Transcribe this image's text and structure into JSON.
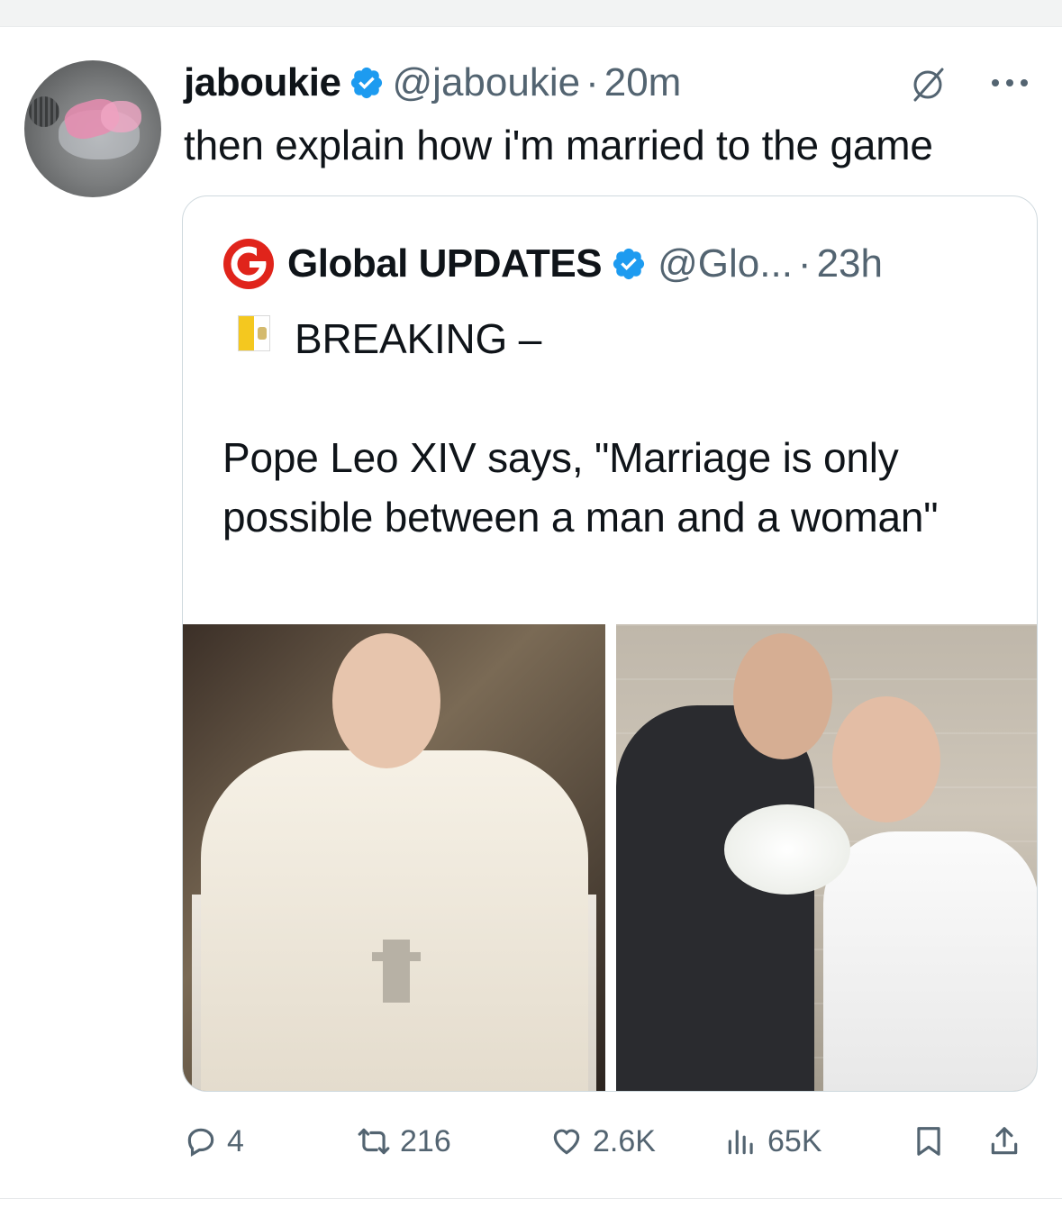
{
  "tweet": {
    "author_name": "jaboukie",
    "author_handle": "@jaboukie",
    "separator": "·",
    "time": "20m",
    "text": "then explain how i'm married to the game"
  },
  "quoted": {
    "author_name": "Global UPDATES",
    "author_handle": "@Glo...",
    "separator": "·",
    "time": "23h",
    "logo_letter": "G",
    "text": "BREAKING –\n\nPope Leo XIV says, \"Marriage is only possible between a man and a woman\""
  },
  "actions": {
    "replies": "4",
    "retweets": "216",
    "likes": "2.6K",
    "views": "65K"
  },
  "icons": {
    "verified": "verified-badge-icon",
    "grok": "grok-icon",
    "more": "more-icon",
    "reply": "reply-icon",
    "retweet": "retweet-icon",
    "like": "heart-icon",
    "views": "views-icon",
    "bookmark": "bookmark-icon",
    "share": "share-icon",
    "flag": "vatican-flag-icon"
  },
  "colors": {
    "verified_blue": "#1d9bf0",
    "muted_text": "#536471",
    "logo_red": "#e0241b"
  }
}
